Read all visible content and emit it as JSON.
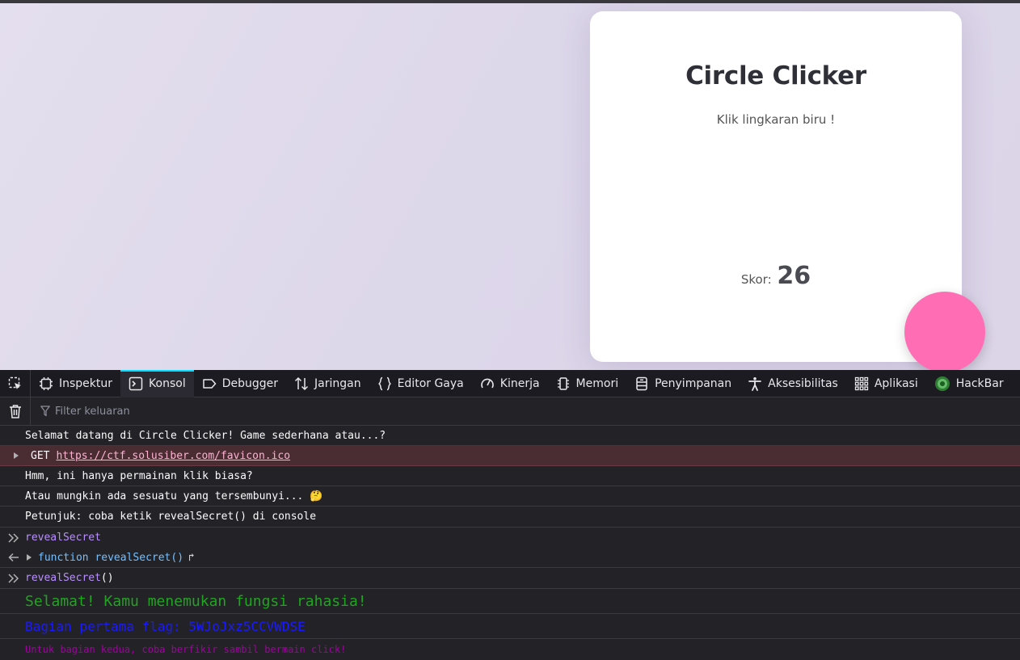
{
  "game": {
    "title": "Circle Clicker",
    "subtitle": "Klik lingkaran biru !",
    "score_label": "Skor:",
    "score_value": "26",
    "circle_color": "#ff6eb5"
  },
  "devtools": {
    "tabs": [
      {
        "label": "Inspektur",
        "icon": "inspector-icon"
      },
      {
        "label": "Konsol",
        "icon": "console-icon",
        "active": true
      },
      {
        "label": "Debugger",
        "icon": "debugger-icon"
      },
      {
        "label": "Jaringan",
        "icon": "network-icon"
      },
      {
        "label": "Editor Gaya",
        "icon": "style-editor-icon"
      },
      {
        "label": "Kinerja",
        "icon": "performance-icon"
      },
      {
        "label": "Memori",
        "icon": "memory-icon"
      },
      {
        "label": "Penyimpanan",
        "icon": "storage-icon"
      },
      {
        "label": "Aksesibilitas",
        "icon": "accessibility-icon"
      },
      {
        "label": "Aplikasi",
        "icon": "application-icon"
      },
      {
        "label": "HackBar",
        "icon": "hackbar-icon"
      }
    ],
    "filter_placeholder": "Filter keluaran",
    "console": {
      "log1": "Selamat datang di Circle Clicker! Game sederhana atau...?",
      "net_method": "GET",
      "net_url": "https://ctf.solusiber.com/favicon.ico",
      "log2": "Hmm, ini hanya permainan klik biasa?",
      "log3": "Atau mungkin ada sesuatu yang tersembunyi... 🤔",
      "log4": "Petunjuk: coba ketik revealSecret() di console",
      "input1": "revealSecret",
      "result_kw": "function",
      "result_name": "revealSecret()",
      "result_arrow": "↱",
      "input2_name": "revealSecret",
      "input2_paren": "()",
      "out_green": "Selamat! Kamu menemukan fungsi rahasia!",
      "out_blue": "Bagian pertama flag: 5WJoJxz5CCVWDSE",
      "out_purple": "Untuk bagian kedua, coba berfikir sambil bermain click!"
    }
  }
}
